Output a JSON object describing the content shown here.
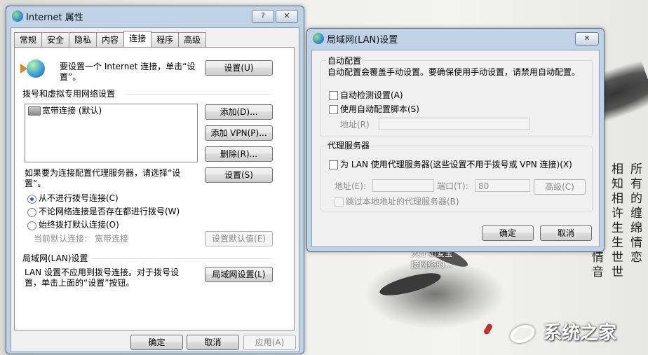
{
  "desktop": {
    "caption_lines": [
      "大厅如爱宝",
      "接网络的..."
    ],
    "poem_columns": [
      "所有的缠绵情恋",
      "相知相许生生世世",
      "情音"
    ],
    "watermark": "系统之家"
  },
  "internet_options": {
    "title": "Internet 属性",
    "help_btn": "?",
    "close_btn": "✕",
    "tabs": [
      "常规",
      "安全",
      "隐私",
      "内容",
      "连接",
      "程序",
      "高级"
    ],
    "setup_text_line1": "要设置一个 Internet 连接，单击“设",
    "setup_text_line2": "置”。",
    "setup_button": "设置(U)",
    "dialup_section": "拨号和虚拟专用网络设置",
    "connections": [
      "宽带连接 (默认)"
    ],
    "add_button": "添加(D)...",
    "add_vpn_button": "添加 VPN(P)...",
    "delete_button": "删除(R)...",
    "proxy_hint_line1": "如果要为连接配置代理服务器，请选择“设",
    "proxy_hint_line2": "置”。",
    "settings_button": "设置(S)",
    "radio_options": [
      "从不进行拨号连接(C)",
      "不论网络连接是否存在都进行拨号(W)",
      "始终拨打默认连接(O)"
    ],
    "selected_radio": 0,
    "current_default_label": "当前默认连接:",
    "current_default_value": "宽带连接",
    "set_default_button": "设置默认值(E)",
    "lan_section": "局域网(LAN)设置",
    "lan_text_line1": "LAN 设置不应用到拨号连接。对于拨号设",
    "lan_text_line2": "置，单击上面的“设置”按钮。",
    "lan_button": "局域网设置(L)",
    "ok_button": "确定",
    "cancel_button": "取消",
    "apply_button": "应用(A)"
  },
  "lan_dialog": {
    "title": "局域网(LAN)设置",
    "close_btn": "✕",
    "auto_config_heading": "自动配置",
    "auto_config_desc": "自动配置会覆盖手动设置。要确保使用手动设置，请禁用自动配置。",
    "auto_detect_label": "自动检测设置(A)",
    "use_script_label": "使用自动配置脚本(S)",
    "address_label": "地址(R)",
    "proxy_heading": "代理服务器",
    "use_proxy_label": "为 LAN 使用代理服务器(这些设置不用于拨号或 VPN 连接)(X)",
    "proxy_address_label": "地址(E):",
    "proxy_port_label": "端口(T):",
    "proxy_port_value": "80",
    "advanced_button": "高级(C)",
    "bypass_local_label": "跳过本地地址的代理服务器(B)",
    "ok_button": "确定",
    "cancel_button": "取消"
  }
}
